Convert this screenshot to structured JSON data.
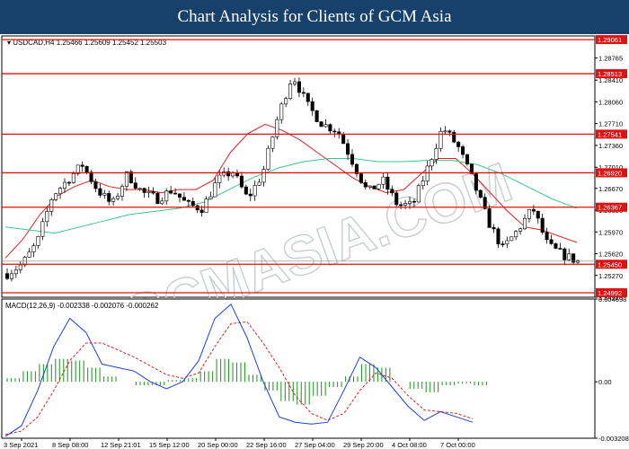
{
  "banner": {
    "title": "Chart Analysis for Clients of GCM Asia"
  },
  "chart_data": [
    {
      "type": "candlestick",
      "header": {
        "symbol": "USDCAD,H4",
        "ohlc": "1.25466 1.25609 1.25452 1.25503"
      },
      "ylim": [
        1.2492,
        1.2912
      ],
      "axis_ticks": [
        "1.28765",
        "1.28410",
        "1.28060",
        "1.27710",
        "1.27360",
        "1.27010",
        "1.26670",
        "1.26320",
        "1.25970",
        "1.25620",
        "1.25270",
        "1.24920"
      ],
      "horizontal_levels": [
        {
          "label": "1.29061",
          "value": 1.29061
        },
        {
          "label": "1.28513",
          "value": 1.28513
        },
        {
          "label": "1.27541",
          "value": 1.27541
        },
        {
          "label": "1.26920",
          "value": 1.2692
        },
        {
          "label": "1.26367",
          "value": 1.26367
        },
        {
          "label": "1.25450",
          "value": 1.2545
        },
        {
          "label": "1.24992",
          "value": 1.24992
        }
      ],
      "x_labels": [
        "3 Sep 2021",
        "8 Sep 08:00",
        "12 Sep 21:01",
        "15 Sep 12:00",
        "20 Sep 00:00",
        "22 Sep 16:00",
        "27 Sep 04:00",
        "29 Sep 20:00",
        "4 Oct 08:00",
        "7 Oct 00:00"
      ],
      "close_path": [
        1.253,
        1.2545,
        1.258,
        1.2655,
        1.268,
        1.2705,
        1.2665,
        1.264,
        1.269,
        1.266,
        1.265,
        1.2665,
        1.264,
        1.2635,
        1.268,
        1.2695,
        1.265,
        1.269,
        1.278,
        1.285,
        1.28,
        1.277,
        1.276,
        1.271,
        1.266,
        1.268,
        1.264,
        1.264,
        1.27,
        1.2765,
        1.2735,
        1.268,
        1.2615,
        1.257,
        1.26,
        1.2635,
        1.2575,
        1.256,
        1.255
      ],
      "series": [
        {
          "name": "Moving Average (red)",
          "values": [
            1.2555,
            1.2585,
            1.2625,
            1.2655,
            1.267,
            1.268,
            1.267,
            1.2665,
            1.2665,
            1.266,
            1.2665,
            1.2665,
            1.268,
            1.2725,
            1.2755,
            1.277,
            1.276,
            1.2745,
            1.2725,
            1.2705,
            1.2685,
            1.267,
            1.266,
            1.2665,
            1.269,
            1.2715,
            1.2715,
            1.269,
            1.266,
            1.263,
            1.2605,
            1.26,
            1.259,
            1.258
          ],
          "color": "#e02020"
        },
        {
          "name": "Moving Average (green)",
          "values": [
            1.2605,
            1.26,
            1.2595,
            1.2605,
            1.2615,
            1.2625,
            1.263,
            1.2635,
            1.2645,
            1.2665,
            1.2685,
            1.27,
            1.271,
            1.2715,
            1.2715,
            1.271,
            1.271,
            1.2712,
            1.2712,
            1.2705,
            1.269,
            1.267,
            1.265,
            1.2635
          ],
          "color": "#3cc88c"
        }
      ],
      "watermark": "GCMASIA.COM"
    },
    {
      "type": "macd",
      "title": "MACD(12,26,9) -0.002338 -0.002076 -0.000262",
      "ylim": [
        -0.003208,
        0.004698
      ],
      "axis_ticks": [
        "0.004698",
        "0.00",
        "-0.003208"
      ],
      "macd_line": [
        -0.0031,
        -0.0025,
        -0.0005,
        0.002,
        0.0036,
        0.0028,
        0.001,
        0.0008,
        0.0006,
        0.0,
        -0.0004,
        0.0,
        0.0012,
        0.0036,
        0.0044,
        0.0025,
        0.0,
        -0.002,
        -0.0023,
        -0.0024,
        -0.0023,
        -0.0005,
        0.0014,
        0.0008,
        -0.0003,
        -0.0014,
        -0.0022,
        -0.0017,
        -0.002,
        -0.0023
      ],
      "signal_line": [
        -0.003,
        -0.0028,
        -0.002,
        -0.0005,
        0.0012,
        0.0022,
        0.0022,
        0.0018,
        0.0014,
        0.0009,
        0.0004,
        0.0002,
        0.0005,
        0.002,
        0.0033,
        0.0034,
        0.0022,
        0.0008,
        -0.0008,
        -0.0018,
        -0.0022,
        -0.0018,
        -0.0005,
        0.0005,
        0.0002,
        -0.0008,
        -0.0016,
        -0.0017,
        -0.0018,
        -0.0021
      ],
      "histogram": [
        0.0002,
        0.0006,
        0.001,
        0.0013,
        0.0012,
        0.0008,
        0.0003,
        0.0,
        -0.0002,
        -0.0002,
        0.0001,
        0.0002,
        0.0006,
        0.0013,
        0.0011,
        0.0004,
        -0.0005,
        -0.0011,
        -0.0013,
        -0.0008,
        -0.0003,
        0.0003,
        0.001,
        0.0008,
        0.0,
        -0.0004,
        -0.0006,
        -0.0002,
        -0.0001,
        -0.0002
      ],
      "colors": {
        "macd": "#1f3fe0",
        "signal": "#e02020",
        "histogram": "#2e9a2e"
      }
    }
  ],
  "colors": {
    "level": "#e01010",
    "level_label_bg": "#e01010",
    "candle": "#000000",
    "banner": "#17406a"
  }
}
